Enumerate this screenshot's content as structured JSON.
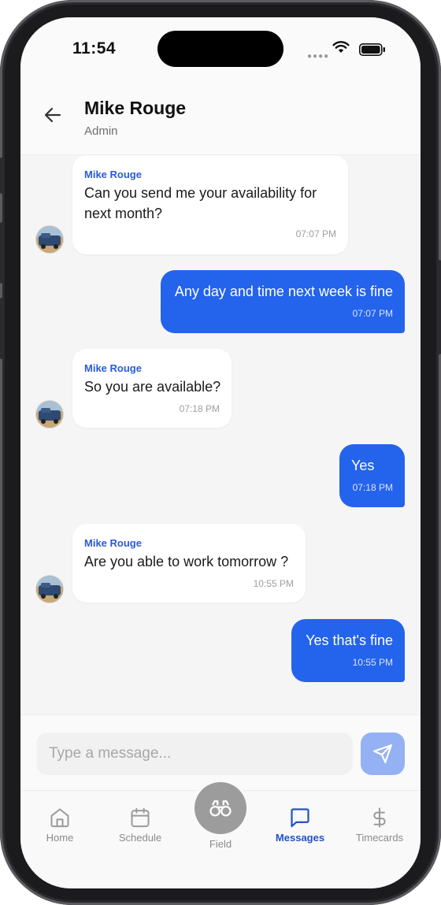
{
  "status_bar": {
    "time": "11:54"
  },
  "header": {
    "title": "Mike Rouge",
    "subtitle": "Admin"
  },
  "messages": [
    {
      "sender": "Mike Rouge",
      "text": "Can you send me your availability for next month?",
      "time": "07:07 PM"
    },
    {
      "text": "Any day and time next week is fine",
      "time": "07:07 PM"
    },
    {
      "sender": "Mike Rouge",
      "text": "So you are available?",
      "time": "07:18 PM"
    },
    {
      "text": "Yes",
      "time": "07:18 PM"
    },
    {
      "sender": "Mike Rouge",
      "text": "Are you able to work tomorrow ?",
      "time": "10:55 PM"
    },
    {
      "text": "Yes that's fine",
      "time": "10:55 PM"
    }
  ],
  "composer": {
    "placeholder": "Type a message..."
  },
  "tabbar": {
    "home": "Home",
    "schedule": "Schedule",
    "field": "Field",
    "messages": "Messages",
    "timecards": "Timecards"
  },
  "colors": {
    "accent": "#2463eb",
    "sender_name": "#2a5bd7",
    "send_button": "#94b1f4",
    "active_tab": "#2451c4"
  }
}
